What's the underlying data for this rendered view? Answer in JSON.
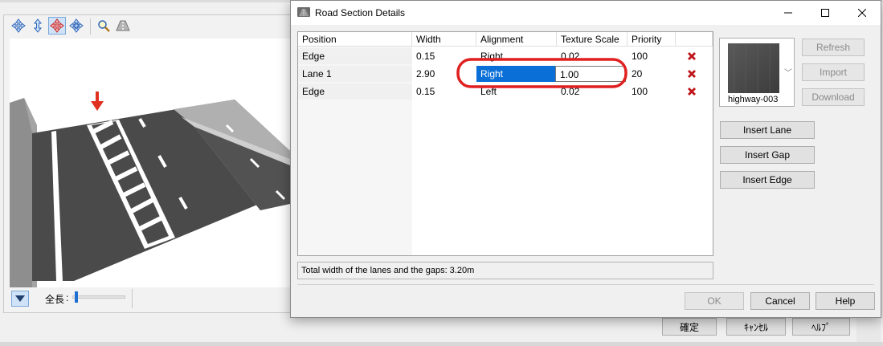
{
  "background_window": {
    "toolbar_icons": [
      "move-icon",
      "vertical-arrows-icon",
      "move-red-icon",
      "rotate-icon",
      "zoom-icon",
      "road-view-icon"
    ],
    "length_label": "全長",
    "length_value": 0.05,
    "footer_buttons": [
      "確定",
      "ｷｬﾝｾﾙ",
      "ﾍﾙﾌﾟ"
    ]
  },
  "dialog": {
    "title": "Road Section Details",
    "columns": [
      "Position",
      "Width",
      "Alignment",
      "Texture Scale",
      "Priority"
    ],
    "rows": [
      {
        "position": "Edge",
        "width": "0.15",
        "alignment": "Right",
        "texture_scale": "0.02",
        "priority": "100"
      },
      {
        "position": "Lane 1",
        "width": "2.90",
        "alignment": "Right",
        "texture_scale": "1.00",
        "priority": "20"
      },
      {
        "position": "Edge",
        "width": "0.15",
        "alignment": "Left",
        "texture_scale": "0.02",
        "priority": "100"
      }
    ],
    "status_text": "Total width of the lanes and the gaps: 3.20m",
    "texture": {
      "name": "highway-003"
    },
    "side_buttons": {
      "refresh": "Refresh",
      "import": "Import",
      "download": "Download"
    },
    "insert_buttons": {
      "lane": "Insert Lane",
      "gap": "Insert Gap",
      "edge": "Insert Edge"
    },
    "footer_buttons": {
      "ok": "OK",
      "cancel": "Cancel",
      "help": "Help"
    },
    "colors": {
      "selection": "#0a6fd6",
      "delete": "#c0161b",
      "highlight": "#e02020"
    }
  }
}
